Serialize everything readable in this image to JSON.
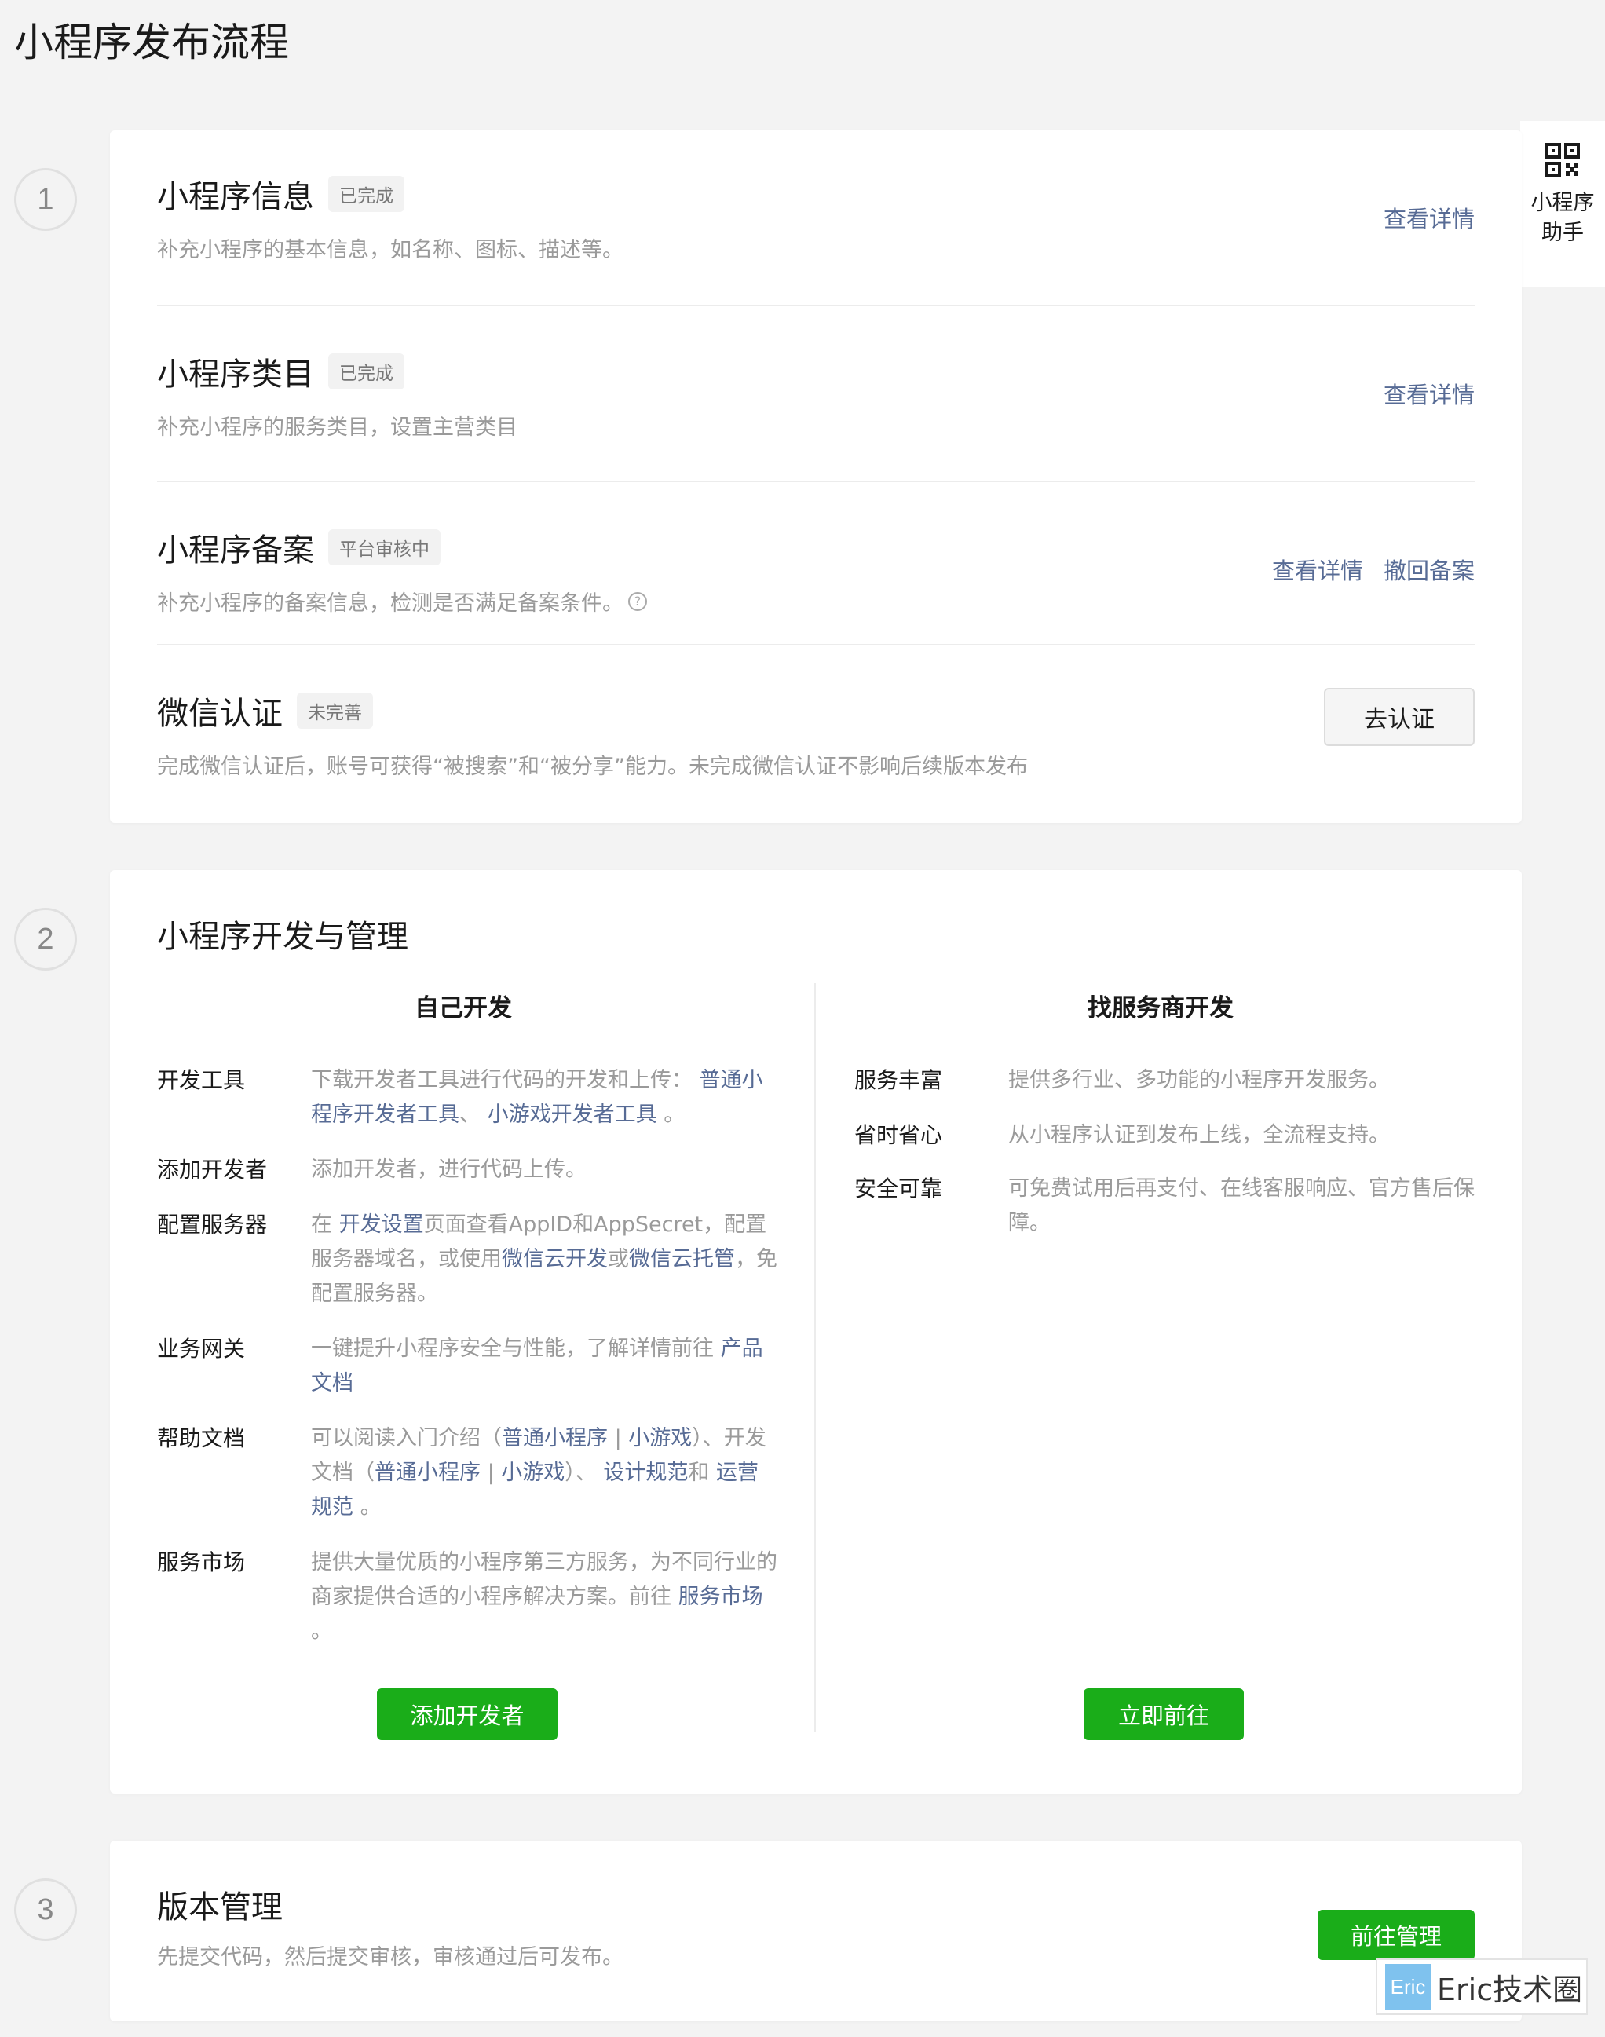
{
  "page_title": "小程序发布流程",
  "helper": {
    "label_line1": "小程序",
    "label_line2": "助手",
    "icon": "qrcode-icon"
  },
  "steps": [
    "1",
    "2",
    "3"
  ],
  "section1": {
    "rows": [
      {
        "title": "小程序信息",
        "badge": "已完成",
        "desc": "补充小程序的基本信息，如名称、图标、描述等。",
        "actions": [
          "查看详情"
        ]
      },
      {
        "title": "小程序类目",
        "badge": "已完成",
        "desc": "补充小程序的服务类目，设置主营类目",
        "actions": [
          "查看详情"
        ]
      },
      {
        "title": "小程序备案",
        "badge": "平台审核中",
        "desc": "补充小程序的备案信息，检测是否满足备案条件。",
        "help_icon": "?",
        "actions": [
          "查看详情",
          "撤回备案"
        ]
      },
      {
        "title": "微信认证",
        "badge": "未完善",
        "desc": "完成微信认证后，账号可获得“被搜索”和“被分享”能力。未完成微信认证不影响后续版本发布",
        "button": "去认证"
      }
    ]
  },
  "section2": {
    "title": "小程序开发与管理",
    "self": {
      "title": "自己开发",
      "items": {
        "devtools": {
          "label": "开发工具",
          "t1": "下载开发者工具进行代码的开发和上传：",
          "l1": "普通",
          "l2": "小程序开发者工具",
          "t2": "、",
          "l3": "小游戏开发者工具",
          "t3": "。"
        },
        "adddev": {
          "label": "添加开发者",
          "t1": "添加开发者，进行代码上传。"
        },
        "server": {
          "label": "配置服务器",
          "t1": "在",
          "l1": "开发设置",
          "t2": "页面查看AppID和AppSecret，配置服务器域名，或使用",
          "l2": "微信云开发",
          "t3": "或",
          "l3": "微信云托管",
          "t4": "，免配置服务器。"
        },
        "gateway": {
          "label": "业务网关",
          "t1": "一键提升小程序安全与性能，了解详情前往",
          "l1": "产",
          "l2": "品文档"
        },
        "docs": {
          "label": "帮助文档",
          "t1": "可以阅读入门介绍（",
          "l1": "普通小程序",
          "sep1": "|",
          "l2": "小游戏",
          "t2": "）、开发文档（",
          "l3": "普通小程序",
          "sep2": "|",
          "l4": "小游戏",
          "t3": "）、",
          "l5": "设计规范",
          "t4": "和",
          "l6": "运",
          "l7": "营规范",
          "t5": "。"
        },
        "market": {
          "label": "服务市场",
          "t1": "提供大量优质的小程序第三方服务，为不同行业的商家提供合适的小程序解决方案。前往",
          "l1": "服务",
          "l2": "市场",
          "t2": "。"
        }
      },
      "button": "添加开发者"
    },
    "vendor": {
      "title": "找服务商开发",
      "items": [
        {
          "label": "服务丰富",
          "text": "提供多行业、多功能的小程序开发服务。"
        },
        {
          "label": "省时省心",
          "text": "从小程序认证到发布上线，全流程支持。"
        },
        {
          "label": "安全可靠",
          "text": "可免费试用后再支付、在线客服响应、官方售后保障。"
        }
      ],
      "button": "立即前往"
    }
  },
  "section3": {
    "title": "版本管理",
    "desc": "先提交代码，然后提交审核，审核通过后可发布。",
    "button": "前往管理"
  },
  "watermark": {
    "logo": "Eric",
    "text": "Eric技术圈"
  }
}
